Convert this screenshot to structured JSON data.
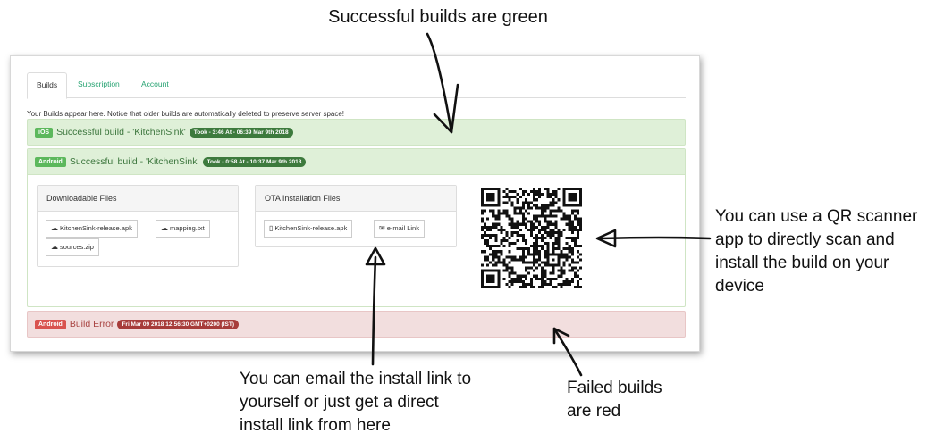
{
  "callouts": {
    "top": "Successful builds are green",
    "qr": [
      "You can use a QR scanner",
      "app to directly scan and",
      "install the build on your",
      "device"
    ],
    "email": [
      "You can email the install link to",
      "yourself or just get a direct",
      "install link from here"
    ],
    "failed": [
      "Failed builds",
      "are red"
    ]
  },
  "tabs": {
    "builds": "Builds",
    "subscription": "Subscription",
    "account": "Account"
  },
  "intro_text": "Your Builds appear here. Notice that older builds are automatically deleted to preserve server space!",
  "builds": [
    {
      "platform": "iOS",
      "title": "Successful build - 'KitchenSink'",
      "meta": "Took - 3:46 At - 06:39 Mar 9th 2018"
    },
    {
      "platform": "Android",
      "title": "Successful build - 'KitchenSink'",
      "meta": "Took - 0:58 At - 10:37 Mar 9th 2018"
    },
    {
      "platform": "Android",
      "title": "Build Error",
      "meta": "Fri Mar 09 2018 12:56:30 GMT+0200 (IST)"
    }
  ],
  "downloadable": {
    "heading": "Downloadable Files",
    "files": [
      "KitchenSink-release.apk",
      "mapping.txt",
      "sources.zip"
    ]
  },
  "ota": {
    "heading": "OTA Installation Files",
    "apk": "KitchenSink-release.apk",
    "email": "e-mail Link"
  },
  "icons": {
    "download": "cloud-download-icon",
    "phone": "mobile-phone-icon",
    "mail": "envelope-icon",
    "qr": "qr-code"
  },
  "colors": {
    "success_bg": "#dff0d8",
    "success_text": "#3c763d",
    "error_bg": "#f2dede",
    "error_text": "#a94442",
    "tab_accent": "#27a372"
  }
}
